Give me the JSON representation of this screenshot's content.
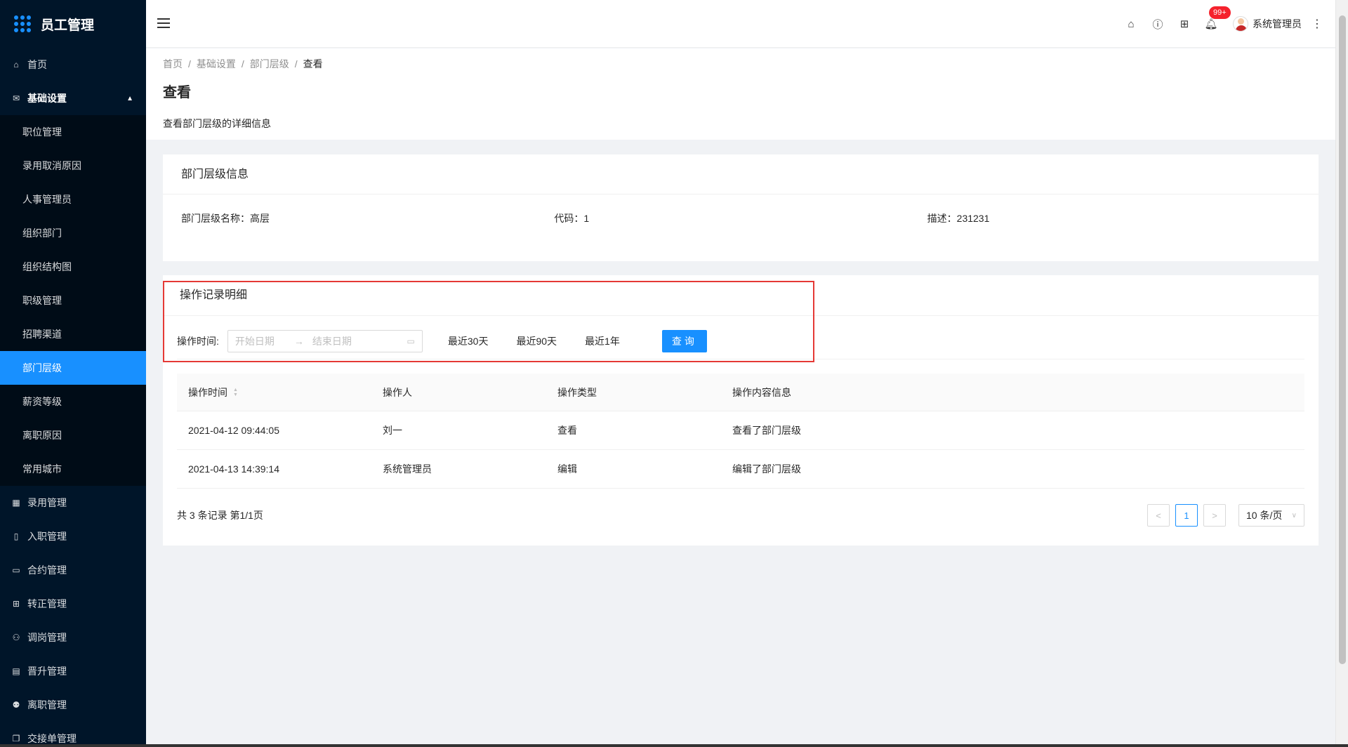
{
  "app": {
    "title": "员工管理"
  },
  "sidebar": {
    "top_items": [
      {
        "label": "首页",
        "icon": "home-icon"
      }
    ],
    "open_group": {
      "label": "基础设置",
      "icon": "mail-icon"
    },
    "sub_items": [
      {
        "label": "职位管理"
      },
      {
        "label": "录用取消原因"
      },
      {
        "label": "人事管理员"
      },
      {
        "label": "组织部门"
      },
      {
        "label": "组织结构图"
      },
      {
        "label": "职级管理"
      },
      {
        "label": "招聘渠道"
      },
      {
        "label": "部门层级"
      },
      {
        "label": "薪资等级"
      },
      {
        "label": "离职原因"
      },
      {
        "label": "常用城市"
      }
    ],
    "groups": [
      {
        "label": "录用管理"
      },
      {
        "label": "入职管理"
      },
      {
        "label": "合约管理"
      },
      {
        "label": "转正管理"
      },
      {
        "label": "调岗管理"
      },
      {
        "label": "晋升管理"
      },
      {
        "label": "离职管理"
      },
      {
        "label": "交接单管理"
      }
    ]
  },
  "header": {
    "notification_count": "99+",
    "user_name": "系统管理员"
  },
  "breadcrumb": [
    "首页",
    "基础设置",
    "部门层级",
    "查看"
  ],
  "breadcrumb_sep": "/",
  "page": {
    "title": "查看",
    "description": "查看部门层级的详细信息"
  },
  "info_card": {
    "title": "部门层级信息",
    "fields": [
      {
        "text": "部门层级名称：高层"
      },
      {
        "text": "代码：1"
      },
      {
        "text": "描述：231231"
      }
    ]
  },
  "log_card": {
    "title": "操作记录明细",
    "filter_label": "操作时间:",
    "start_placeholder": "开始日期",
    "end_placeholder": "结束日期",
    "arrow": "→",
    "quick_ranges": [
      "最近30天",
      "最近90天",
      "最近1年"
    ],
    "query_button": "查询"
  },
  "table": {
    "columns": [
      "操作时间",
      "操作人",
      "操作类型",
      "操作内容信息"
    ],
    "rows": [
      [
        "2021-04-12 09:44:05",
        "刘一",
        "查看",
        "查看了部门层级"
      ],
      [
        "2021-04-13 14:39:14",
        "系统管理员",
        "编辑",
        "编辑了部门层级"
      ]
    ]
  },
  "pagination": {
    "summary": "共 3 条记录 第1/1页",
    "current_page": "1",
    "page_size": "10 条/页",
    "prev": "<",
    "next": ">"
  },
  "colors": {
    "sidebar_bg": "#001529",
    "primary": "#1890ff",
    "highlight_border": "#e53935",
    "badge": "#f5222d"
  }
}
